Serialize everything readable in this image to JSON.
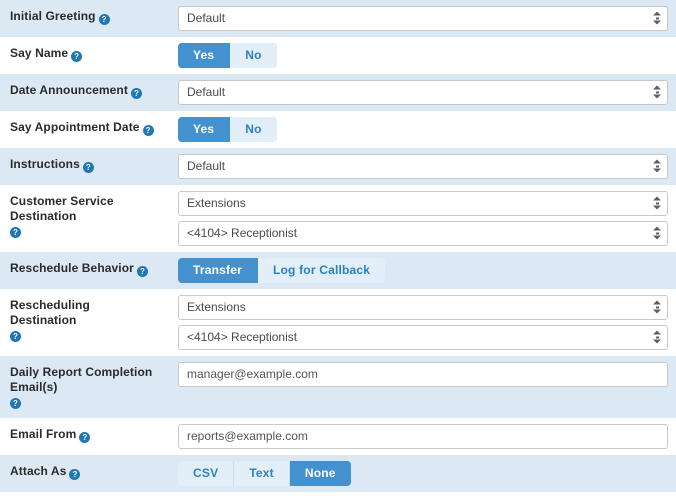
{
  "form": {
    "help_glyph": "?",
    "rows": [
      {
        "id": "initial-greeting",
        "label": "Initial Greeting",
        "help": true,
        "help_inline": true,
        "striped": true,
        "control": "select",
        "selects": [
          {
            "value": "Default"
          }
        ]
      },
      {
        "id": "say-name",
        "label": "Say Name",
        "help": true,
        "help_inline": true,
        "striped": false,
        "control": "buttons",
        "buttons": [
          {
            "label": "Yes",
            "active": true
          },
          {
            "label": "No",
            "active": false
          }
        ]
      },
      {
        "id": "date-announcement",
        "label": "Date Announcement",
        "help": true,
        "help_inline": true,
        "striped": true,
        "control": "select",
        "selects": [
          {
            "value": "Default"
          }
        ]
      },
      {
        "id": "say-appointment-date",
        "label": "Say Appointment Date",
        "help": true,
        "help_inline": true,
        "striped": false,
        "control": "buttons",
        "buttons": [
          {
            "label": "Yes",
            "active": true
          },
          {
            "label": "No",
            "active": false
          }
        ]
      },
      {
        "id": "instructions",
        "label": "Instructions",
        "help": true,
        "help_inline": true,
        "striped": true,
        "control": "select",
        "selects": [
          {
            "value": "Default"
          }
        ]
      },
      {
        "id": "customer-service-destination",
        "label": "Customer Service Destination",
        "help": true,
        "help_inline": false,
        "striped": false,
        "control": "select",
        "selects": [
          {
            "value": "Extensions"
          },
          {
            "value": "<4104> Receptionist"
          }
        ]
      },
      {
        "id": "reschedule-behavior",
        "label": "Reschedule Behavior",
        "help": true,
        "help_inline": true,
        "striped": true,
        "control": "buttons",
        "buttons": [
          {
            "label": "Transfer",
            "active": true
          },
          {
            "label": "Log for Callback",
            "active": false
          }
        ]
      },
      {
        "id": "rescheduling-destination",
        "label": "Rescheduling Destination",
        "help": true,
        "help_inline": false,
        "striped": false,
        "control": "select",
        "selects": [
          {
            "value": "Extensions"
          },
          {
            "value": "<4104> Receptionist"
          }
        ]
      },
      {
        "id": "daily-report-completion-emails",
        "label": "Daily Report Completion Email(s)",
        "help": true,
        "help_inline": false,
        "striped": true,
        "control": "input",
        "input": {
          "value": "manager@example.com",
          "placeholder": ""
        }
      },
      {
        "id": "email-from",
        "label": "Email From",
        "help": true,
        "help_inline": true,
        "striped": false,
        "control": "input",
        "input": {
          "value": "reports@example.com",
          "placeholder": ""
        }
      },
      {
        "id": "attach-as",
        "label": "Attach As",
        "help": true,
        "help_inline": true,
        "striped": true,
        "control": "buttons",
        "buttons": [
          {
            "label": "CSV",
            "active": false
          },
          {
            "label": "Text",
            "active": false
          },
          {
            "label": "None",
            "active": true
          }
        ]
      }
    ]
  },
  "colors": {
    "accent_blue": "#4391cf",
    "striped_row": "#dce9f4",
    "button_group_bg": "#e3eff8",
    "button_text": "#2d7fbe",
    "help_icon": "#1d78b5"
  }
}
